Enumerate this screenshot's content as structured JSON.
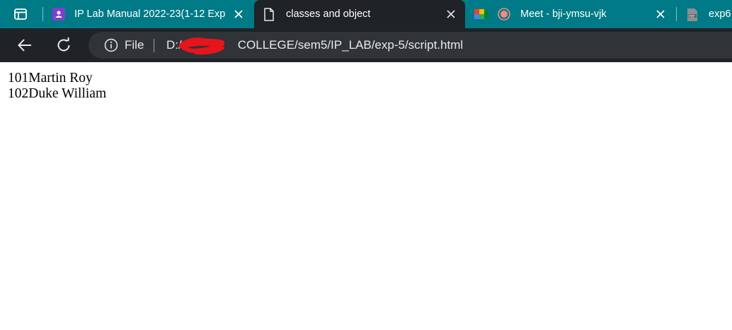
{
  "tabs": [
    {
      "title": "IP Lab Manual 2022-23(1-12 Exp",
      "icon": "google-classroom-icon",
      "active": false
    },
    {
      "title": "classes and object",
      "icon": "file-icon",
      "active": true
    },
    {
      "title": "Meet - bji-ymsu-vjk",
      "icon": "google-meet-icon",
      "active": false,
      "recording": true
    },
    {
      "title": "exp6",
      "icon": "pdf-icon",
      "active": false
    }
  ],
  "toolbar": {
    "scheme_label": "File",
    "url": "D:/…/COLLEGE/sem5/IP_LAB/exp-5/script.html",
    "url_prefix": "D:/",
    "url_rest": "COLLEGE/sem5/IP_LAB/exp-5/script.html"
  },
  "content": {
    "lines": [
      "101Martin Roy",
      "102Duke William"
    ]
  },
  "colors": {
    "tabstrip": "#007a87",
    "active_tab": "#1f2226",
    "toolbar": "#1f2226",
    "omnibox": "#303338",
    "redaction": "#e8141c",
    "recording": "#f28b82"
  }
}
